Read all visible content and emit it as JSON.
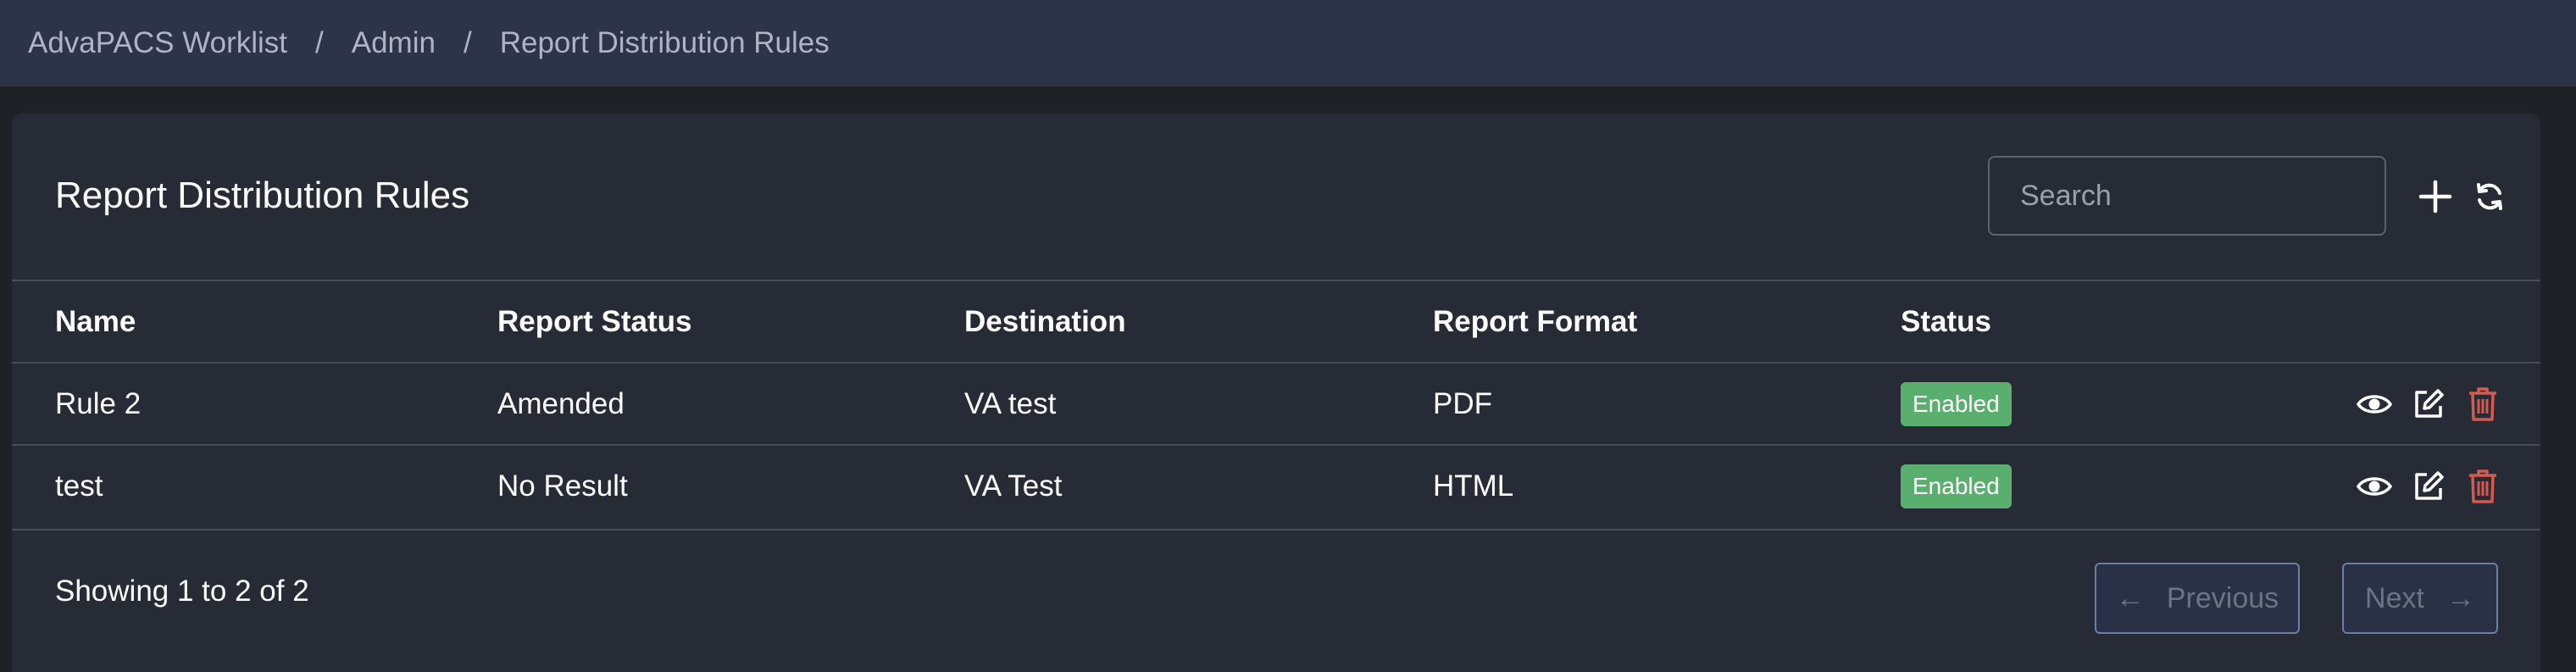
{
  "breadcrumb": {
    "items": [
      "AdvaPACS Worklist",
      "Admin",
      "Report Distribution Rules"
    ],
    "separator": "/"
  },
  "page": {
    "title": "Report Distribution Rules",
    "search_placeholder": "Search"
  },
  "table": {
    "headers": [
      "Name",
      "Report Status",
      "Destination",
      "Report Format",
      "Status"
    ],
    "rows": [
      {
        "name": "Rule 2",
        "report_status": "Amended",
        "destination": "VA test",
        "format": "PDF",
        "status": "Enabled"
      },
      {
        "name": "test",
        "report_status": "No Result",
        "destination": "VA Test",
        "format": "HTML",
        "status": "Enabled"
      }
    ]
  },
  "pagination": {
    "summary": "Showing 1 to 2 of 2",
    "previous_label": "Previous",
    "previous_arrow": "←",
    "next_label": "Next",
    "next_arrow": "→"
  },
  "icons": [
    "plus-icon",
    "refresh-icon",
    "eye-icon",
    "edit-icon",
    "trash-icon"
  ],
  "colors": {
    "topbar_bg": "#2d3447",
    "card_bg": "#272b36",
    "badge_enabled": "#5aaf6f",
    "delete_icon": "#d45a4f",
    "pagination_border": "#6a7ea8"
  }
}
